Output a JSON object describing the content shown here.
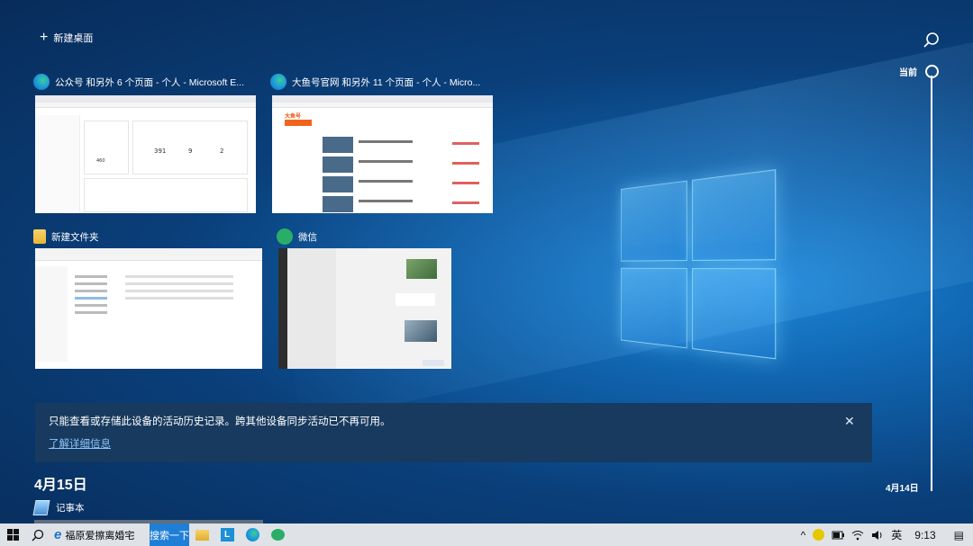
{
  "new_desktop": {
    "label": "新建桌面"
  },
  "timeline": {
    "current": "当前",
    "date_marker": "4月14日"
  },
  "windows": [
    {
      "title": "公众号 和另外 6 个页面 - 个人 - Microsoft E...",
      "icon": "edge-icon",
      "stats": [
        "391",
        "9",
        "2"
      ],
      "stat_extra": "460"
    },
    {
      "title": "大鱼号官网 和另外 11 个页面 - 个人 - Micro...",
      "icon": "edge-icon",
      "thumb_logo": "大鱼号"
    },
    {
      "title": "新建文件夹",
      "icon": "folder-icon"
    },
    {
      "title": "微信",
      "icon": "wechat-icon"
    }
  ],
  "notice": {
    "message": "只能查看或存储此设备的活动历史记录。跨其他设备同步活动已不再可用。",
    "link": "了解详细信息",
    "close": "✕"
  },
  "history": {
    "date": "4月15日",
    "items": [
      {
        "label": "记事本",
        "icon": "notepad-icon"
      }
    ]
  },
  "taskbar": {
    "ie_label": "福原爱擦离婚宅",
    "search_more": "搜索一下",
    "ime": "英",
    "time": "9:13",
    "tray_up": "^",
    "notification": "▤"
  },
  "colors": {
    "taskbar_bg": "#dfe3e8",
    "notice_bg": "#173a5e",
    "accent": "#1f7fd6"
  }
}
